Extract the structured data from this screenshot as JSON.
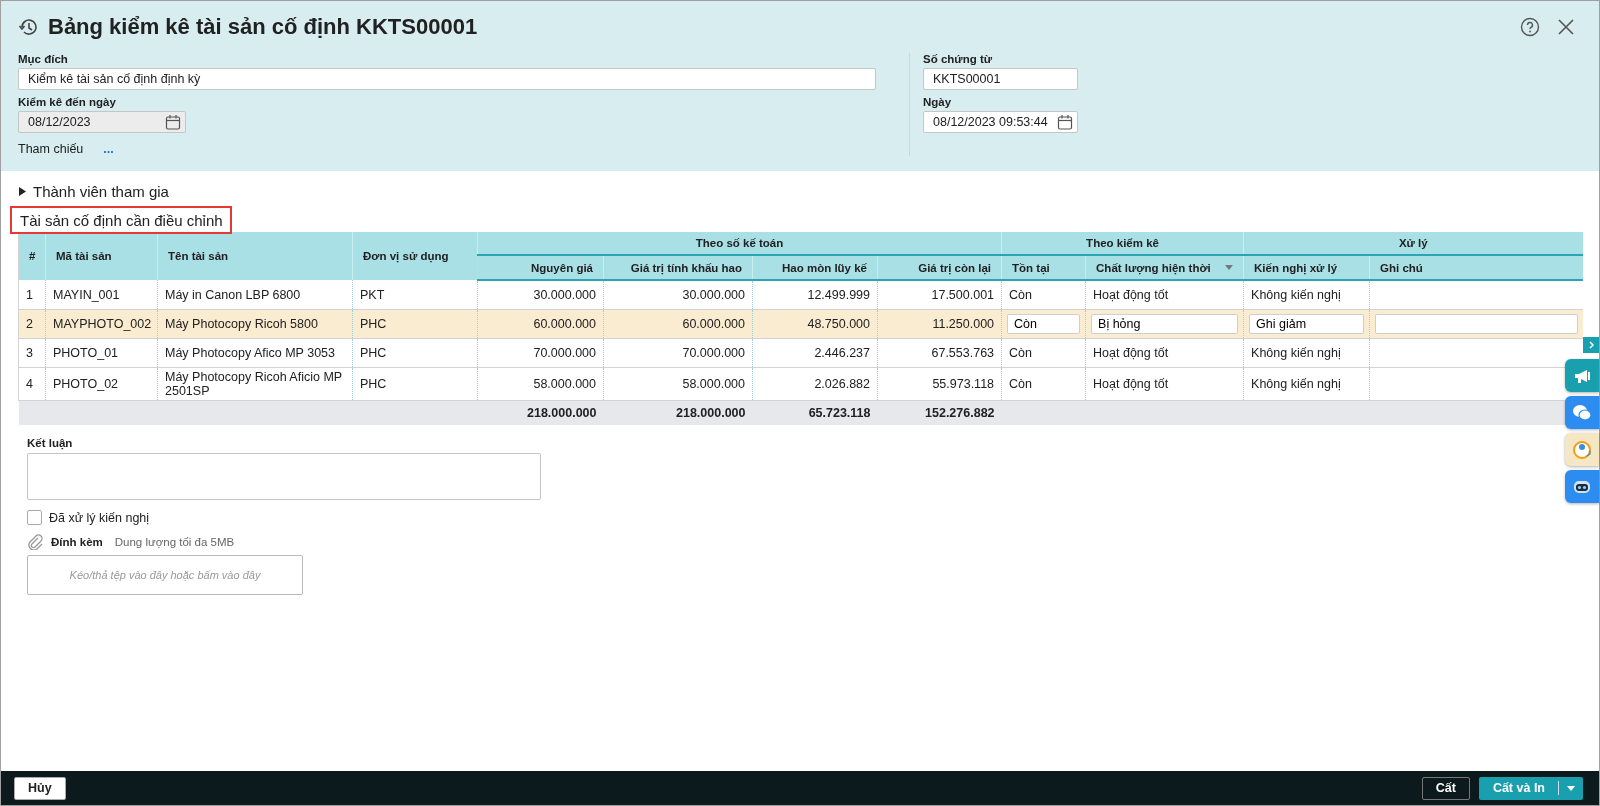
{
  "window": {
    "title": "Bảng kiểm kê tài sản cố định KKTS00001"
  },
  "header_form": {
    "purpose": {
      "label": "Mục đích",
      "value": "Kiểm kê tài sản cố định định kỳ"
    },
    "inventory_date": {
      "label": "Kiểm kê đến ngày",
      "value": "08/12/2023",
      "disabled": true
    },
    "reference": {
      "label": "Tham chiếu",
      "link": "..."
    },
    "voucher_no": {
      "label": "Số chứng từ",
      "value": "KKTS00001"
    },
    "date": {
      "label": "Ngày",
      "value": "08/12/2023 09:53:44",
      "disabled": false
    }
  },
  "members_section": {
    "label": "Thành viên tham gia",
    "expanded": false
  },
  "assets_section": {
    "title": "Tài sản cố định cần điều chỉnh",
    "highlighted": true
  },
  "table": {
    "header": [
      {
        "kind": "single",
        "label": "#"
      },
      {
        "kind": "single",
        "label": "Mã tài sản"
      },
      {
        "kind": "single",
        "label": "Tên tài sản"
      },
      {
        "kind": "single",
        "label": "Đơn vị sử dụng"
      },
      {
        "kind": "group",
        "label": "Theo số kế toán",
        "columns": [
          {
            "label": "Nguyên giá",
            "menu": false
          },
          {
            "label": "Giá trị tính khấu hao",
            "menu": false
          },
          {
            "label": "Hao mòn lũy kế",
            "menu": false
          },
          {
            "label": "Giá trị còn lại",
            "menu": false
          }
        ]
      },
      {
        "kind": "group",
        "label": "Theo kiểm kê",
        "columns": [
          {
            "label": "Tồn tại",
            "menu": false
          },
          {
            "label": "Chất lượng hiện thời",
            "menu": true
          }
        ]
      },
      {
        "kind": "group",
        "label": "Xử lý",
        "columns": [
          {
            "label": "Kiến nghị xử lý",
            "menu": false
          },
          {
            "label": "Ghi chú",
            "menu": false
          }
        ]
      }
    ],
    "rows": [
      {
        "selected": false,
        "cells": [
          "1",
          "MAYIN_001",
          "Máy in Canon LBP 6800",
          "PKT",
          "30.000.000",
          "30.000.000",
          "12.499.999",
          "17.500.001",
          "Còn",
          "Hoạt động tốt",
          "Không kiến nghị"
        ]
      },
      {
        "selected": true,
        "cells": [
          "2",
          "MAYPHOTO_002",
          "Máy Photocopy Ricoh 5800",
          "PHC",
          "60.000.000",
          "60.000.000",
          "48.750.000",
          "11.250.000",
          "Còn",
          "Bị hỏng",
          "Ghi giảm"
        ]
      },
      {
        "selected": false,
        "cells": [
          "3",
          "PHOTO_01",
          "Máy Photocopy Afico MP 3053",
          "PHC",
          "70.000.000",
          "70.000.000",
          "2.446.237",
          "67.553.763",
          "Còn",
          "Hoạt động tốt",
          "Không kiến nghị"
        ]
      },
      {
        "selected": false,
        "cells": [
          "4",
          "PHOTO_02",
          "Máy Photocopy Ricoh Aficio MP 2501SP",
          "PHC",
          "58.000.000",
          "58.000.000",
          "2.026.882",
          "55.973.118",
          "Còn",
          "Hoạt động tốt",
          "Không kiến nghị"
        ]
      }
    ],
    "totals": [
      "218.000.000",
      "218.000.000",
      "65.723.118",
      "152.276.882"
    ]
  },
  "conclusion": {
    "label": "Kết luận"
  },
  "processed_checkbox": {
    "label": "Đã xử lý kiến nghị",
    "checked": false
  },
  "attachment": {
    "label": "Đính kèm",
    "hint": "Dung lượng tối đa 5MB",
    "dropzone": "Kéo/thả tệp vào đây hoặc bấm vào đây"
  },
  "footer": {
    "cancel": "Hủy",
    "save": "Cất",
    "save_print": "Cất và In"
  }
}
